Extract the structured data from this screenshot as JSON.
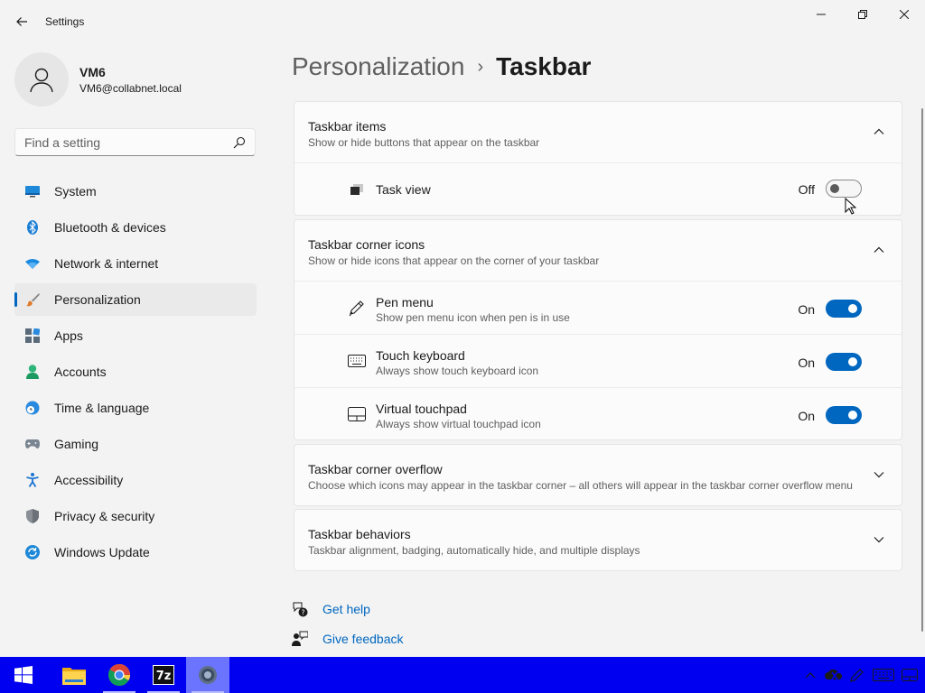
{
  "window": {
    "title": "Settings",
    "controls": {
      "minimize": "minimize-icon",
      "maximize": "restore-icon",
      "close": "close-icon"
    }
  },
  "profile": {
    "name": "VM6",
    "email": "VM6@collabnet.local"
  },
  "search": {
    "placeholder": "Find a setting"
  },
  "sidebar": {
    "items": [
      {
        "label": "System",
        "icon": "monitor-icon"
      },
      {
        "label": "Bluetooth & devices",
        "icon": "bluetooth-icon"
      },
      {
        "label": "Network & internet",
        "icon": "wifi-icon"
      },
      {
        "label": "Personalization",
        "icon": "brush-icon",
        "active": true
      },
      {
        "label": "Apps",
        "icon": "apps-icon"
      },
      {
        "label": "Accounts",
        "icon": "person-icon"
      },
      {
        "label": "Time & language",
        "icon": "clock-globe-icon"
      },
      {
        "label": "Gaming",
        "icon": "gamepad-icon"
      },
      {
        "label": "Accessibility",
        "icon": "accessibility-icon"
      },
      {
        "label": "Privacy & security",
        "icon": "shield-icon"
      },
      {
        "label": "Windows Update",
        "icon": "update-icon"
      }
    ]
  },
  "breadcrumb": {
    "parent": "Personalization",
    "separator": "›",
    "current": "Taskbar"
  },
  "sections": {
    "taskbar_items": {
      "title": "Taskbar items",
      "desc": "Show or hide buttons that appear on the taskbar",
      "expanded": true,
      "rows": [
        {
          "title": "Task view",
          "state_label": "Off",
          "on": false,
          "icon": "task-view-icon"
        }
      ]
    },
    "corner_icons": {
      "title": "Taskbar corner icons",
      "desc": "Show or hide icons that appear on the corner of your taskbar",
      "expanded": true,
      "rows": [
        {
          "title": "Pen menu",
          "desc": "Show pen menu icon when pen is in use",
          "state_label": "On",
          "on": true,
          "icon": "pen-icon"
        },
        {
          "title": "Touch keyboard",
          "desc": "Always show touch keyboard icon",
          "state_label": "On",
          "on": true,
          "icon": "keyboard-icon"
        },
        {
          "title": "Virtual touchpad",
          "desc": "Always show virtual touchpad icon",
          "state_label": "On",
          "on": true,
          "icon": "touchpad-icon"
        }
      ]
    },
    "corner_overflow": {
      "title": "Taskbar corner overflow",
      "desc": "Choose which icons may appear in the taskbar corner – all others will appear in the taskbar corner overflow menu",
      "expanded": false
    },
    "behaviors": {
      "title": "Taskbar behaviors",
      "desc": "Taskbar alignment, badging, automatically hide, and multiple displays",
      "expanded": false
    }
  },
  "links": {
    "help": "Get help",
    "feedback": "Give feedback"
  },
  "taskbar": {
    "apps": [
      "start-icon",
      "file-explorer-icon",
      "chrome-icon",
      "7zip-icon",
      "settings-icon"
    ],
    "tray": [
      "chevron-up-icon",
      "onedrive-icon",
      "pen-icon",
      "keyboard-icon",
      "touchpad-icon"
    ]
  },
  "colors": {
    "accent": "#0067c0",
    "taskbar": "#0000f0",
    "background": "#f3f3f3"
  }
}
